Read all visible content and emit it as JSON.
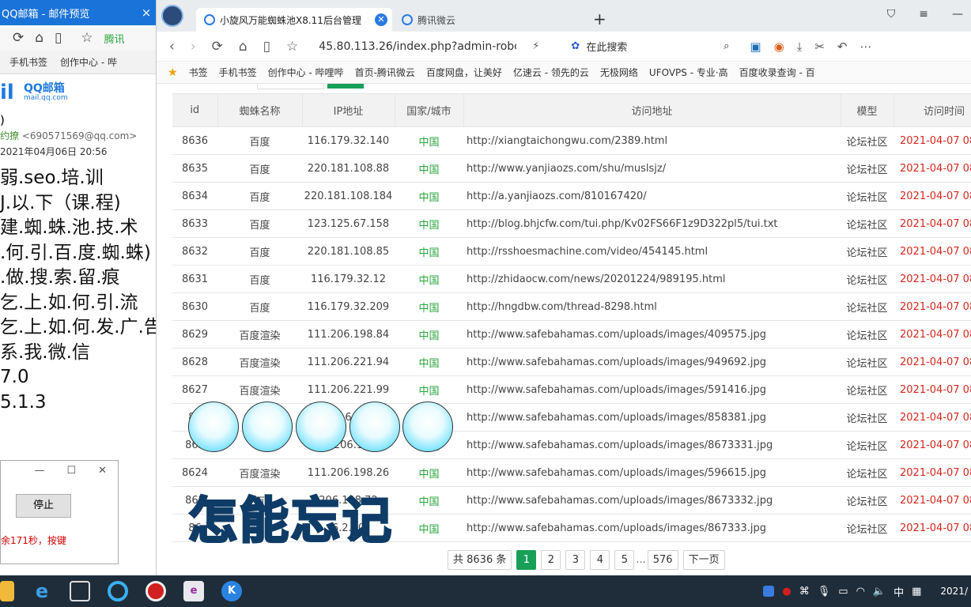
{
  "left_window": {
    "title": "QQ邮箱 - 邮件预览",
    "close_glyph": "×",
    "bookmark_items": [
      "手机书签",
      "创作中心 - 哔"
    ],
    "tencent_label": "腾讯",
    "logo_name": "QQ邮箱",
    "logo_sub": "mail.qq.com",
    "subject": ")",
    "from_name": "约撩",
    "from_email": "<690571569@qq.com>",
    "date": "2021年04月06日 20:56",
    "body_lines": [
      "弱.seo.培.训",
      "J.以.下（课.程)",
      "建.蜘.蛛.池.技.术",
      ".何.引.百.度.蜘.蛛)",
      ".做.搜.索.留.痕",
      "乞.上.如.何.引.流",
      "乞.上.如.何.发.广.告",
      "系.我.微.信",
      "7.0",
      "5.1.3"
    ],
    "timer": {
      "stop_label": "停止",
      "message": "余171秒，按键"
    }
  },
  "browser": {
    "tabs": [
      {
        "label": "小旋风万能蜘蛛池X8.11后台管理",
        "active": true
      },
      {
        "label": "腾讯微云",
        "active": false
      }
    ],
    "url": "45.80.113.26/index.php?admin-robc",
    "search_placeholder": "在此搜索",
    "bookmarks": [
      "书签",
      "手机书签",
      "创作中心 - 哔哩哔",
      "首页-腾讯微云",
      "百度网盘，让美好",
      "亿速云 - 领先的云",
      "无极网络",
      "UFOVPS - 专业·高",
      "百度收录查询 - 百"
    ]
  },
  "table": {
    "columns": [
      "id",
      "蜘蛛名称",
      "IP地址",
      "国家/城市",
      "访问地址",
      "模型",
      "访问时间"
    ],
    "rows": [
      [
        "8636",
        "百度",
        "116.179.32.140",
        "中国",
        "http://xiangtaichongwu.com/2389.html",
        "论坛社区",
        "2021-04-07 08"
      ],
      [
        "8635",
        "百度",
        "220.181.108.88",
        "中国",
        "http://www.yanjiaozs.com/shu/muslsjz/",
        "论坛社区",
        "2021-04-07 08"
      ],
      [
        "8634",
        "百度",
        "220.181.108.184",
        "中国",
        "http://a.yanjiaozs.com/810167420/",
        "论坛社区",
        "2021-04-07 08"
      ],
      [
        "8633",
        "百度",
        "123.125.67.158",
        "中国",
        "http://blog.bhjcfw.com/tui.php/Kv02FS66F1z9D322pl5/tui.txt",
        "论坛社区",
        "2021-04-07 08"
      ],
      [
        "8632",
        "百度",
        "220.181.108.85",
        "中国",
        "http://rsshoesmachine.com/video/454145.html",
        "论坛社区",
        "2021-04-07 08"
      ],
      [
        "8631",
        "百度",
        "116.179.32.12",
        "中国",
        "http://zhidaocw.com/news/20201224/989195.html",
        "论坛社区",
        "2021-04-07 08"
      ],
      [
        "8630",
        "百度",
        "116.179.32.209",
        "中国",
        "http://hngdbw.com/thread-8298.html",
        "论坛社区",
        "2021-04-07 08"
      ],
      [
        "8629",
        "百度渲染",
        "111.206.198.84",
        "中国",
        "http://www.safebahamas.com/uploads/images/409575.jpg",
        "论坛社区",
        "2021-04-07 08"
      ],
      [
        "8628",
        "百度渲染",
        "111.206.221.94",
        "中国",
        "http://www.safebahamas.com/uploads/images/949692.jpg",
        "论坛社区",
        "2021-04-07 08"
      ],
      [
        "8627",
        "百度渲染",
        "111.206.221.99",
        "中国",
        "http://www.safebahamas.com/uploads/images/591416.jpg",
        "论坛社区",
        "2021-04-07 08"
      ],
      [
        "86",
        "",
        "6",
        "中国",
        "http://www.safebahamas.com/uploads/images/858381.jpg",
        "论坛社区",
        "2021-04-07 08"
      ],
      [
        "862",
        "",
        "206.1",
        "中国",
        "http://www.safebahamas.com/uploads/images/8673331.jpg",
        "论坛社区",
        "2021-04-07 08"
      ],
      [
        "8624",
        "百度渲染",
        "111.206.198.26",
        "中国",
        "http://www.safebahamas.com/uploads/images/596615.jpg",
        "论坛社区",
        "2021-04-07 08"
      ],
      [
        "862",
        "百",
        "206.198.72",
        "中国",
        "http://www.safebahamas.com/uploads/images/8673332.jpg",
        "论坛社区",
        "2021-04-07 08"
      ],
      [
        "86",
        "",
        "6.2.30",
        "中国",
        "http://www.safebahamas.com/uploads/images/867333.jpg",
        "论坛社区",
        "2021-04-07 08"
      ]
    ]
  },
  "pager": {
    "total": "共 8636 条",
    "pages": [
      "1",
      "2",
      "3",
      "4",
      "5"
    ],
    "current": "1",
    "ellipsis": "...",
    "last": "576",
    "next": "下一页"
  },
  "overlay": {
    "caption": "怎能忘记"
  },
  "taskbar": {
    "ime": "中",
    "date": "2021/"
  },
  "colors": {
    "accent": "#18a058",
    "country": "#2aa63c",
    "time": "#d4281e",
    "caption": "#16b8e8"
  }
}
